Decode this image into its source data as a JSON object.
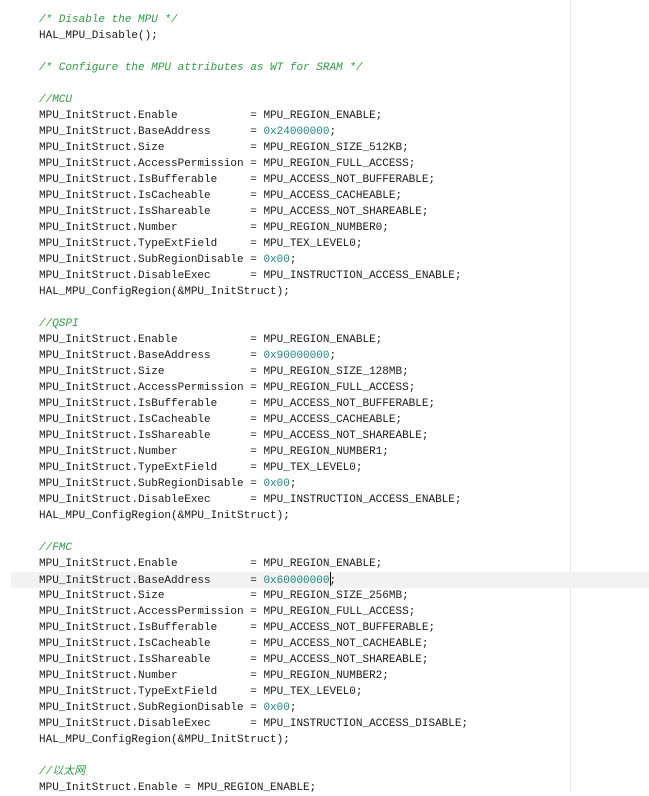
{
  "editor": {
    "active_line": 35,
    "lines": [
      {
        "type": "comment",
        "text": "/* Disable the MPU */"
      },
      {
        "type": "code",
        "text": "HAL_MPU_Disable();"
      },
      {
        "type": "blank",
        "text": ""
      },
      {
        "type": "comment",
        "text": "/* Configure the MPU attributes as WT for SRAM */"
      },
      {
        "type": "blank",
        "text": ""
      },
      {
        "type": "comment",
        "text": "//MCU"
      },
      {
        "type": "assign",
        "lhs": "MPU_InitStruct.Enable",
        "rhs": "MPU_REGION_ENABLE",
        "numeric": false
      },
      {
        "type": "assign",
        "lhs": "MPU_InitStruct.BaseAddress",
        "rhs": "0x24000000",
        "numeric": true
      },
      {
        "type": "assign",
        "lhs": "MPU_InitStruct.Size",
        "rhs": "MPU_REGION_SIZE_512KB",
        "numeric": false
      },
      {
        "type": "assign",
        "lhs": "MPU_InitStruct.AccessPermission",
        "rhs": "MPU_REGION_FULL_ACCESS",
        "numeric": false
      },
      {
        "type": "assign",
        "lhs": "MPU_InitStruct.IsBufferable",
        "rhs": "MPU_ACCESS_NOT_BUFFERABLE",
        "numeric": false
      },
      {
        "type": "assign",
        "lhs": "MPU_InitStruct.IsCacheable",
        "rhs": "MPU_ACCESS_CACHEABLE",
        "numeric": false
      },
      {
        "type": "assign",
        "lhs": "MPU_InitStruct.IsShareable",
        "rhs": "MPU_ACCESS_NOT_SHAREABLE",
        "numeric": false
      },
      {
        "type": "assign",
        "lhs": "MPU_InitStruct.Number",
        "rhs": "MPU_REGION_NUMBER0",
        "numeric": false
      },
      {
        "type": "assign",
        "lhs": "MPU_InitStruct.TypeExtField",
        "rhs": "MPU_TEX_LEVEL0",
        "numeric": false
      },
      {
        "type": "assign",
        "lhs": "MPU_InitStruct.SubRegionDisable",
        "rhs": "0x00",
        "numeric": true
      },
      {
        "type": "assign",
        "lhs": "MPU_InitStruct.DisableExec",
        "rhs": "MPU_INSTRUCTION_ACCESS_ENABLE",
        "numeric": false
      },
      {
        "type": "code",
        "text": "HAL_MPU_ConfigRegion(&MPU_InitStruct);"
      },
      {
        "type": "blank",
        "text": ""
      },
      {
        "type": "comment",
        "text": "//QSPI"
      },
      {
        "type": "assign",
        "lhs": "MPU_InitStruct.Enable",
        "rhs": "MPU_REGION_ENABLE",
        "numeric": false
      },
      {
        "type": "assign",
        "lhs": "MPU_InitStruct.BaseAddress",
        "rhs": "0x90000000",
        "numeric": true
      },
      {
        "type": "assign",
        "lhs": "MPU_InitStruct.Size",
        "rhs": "MPU_REGION_SIZE_128MB",
        "numeric": false
      },
      {
        "type": "assign",
        "lhs": "MPU_InitStruct.AccessPermission",
        "rhs": "MPU_REGION_FULL_ACCESS",
        "numeric": false
      },
      {
        "type": "assign",
        "lhs": "MPU_InitStruct.IsBufferable",
        "rhs": "MPU_ACCESS_NOT_BUFFERABLE",
        "numeric": false
      },
      {
        "type": "assign",
        "lhs": "MPU_InitStruct.IsCacheable",
        "rhs": "MPU_ACCESS_CACHEABLE",
        "numeric": false
      },
      {
        "type": "assign",
        "lhs": "MPU_InitStruct.IsShareable",
        "rhs": "MPU_ACCESS_NOT_SHAREABLE",
        "numeric": false
      },
      {
        "type": "assign",
        "lhs": "MPU_InitStruct.Number",
        "rhs": "MPU_REGION_NUMBER1",
        "numeric": false
      },
      {
        "type": "assign",
        "lhs": "MPU_InitStruct.TypeExtField",
        "rhs": "MPU_TEX_LEVEL0",
        "numeric": false
      },
      {
        "type": "assign",
        "lhs": "MPU_InitStruct.SubRegionDisable",
        "rhs": "0x00",
        "numeric": true
      },
      {
        "type": "assign",
        "lhs": "MPU_InitStruct.DisableExec",
        "rhs": "MPU_INSTRUCTION_ACCESS_ENABLE",
        "numeric": false
      },
      {
        "type": "code",
        "text": "HAL_MPU_ConfigRegion(&MPU_InitStruct);"
      },
      {
        "type": "blank",
        "text": ""
      },
      {
        "type": "comment",
        "text": "//FMC"
      },
      {
        "type": "assign",
        "lhs": "MPU_InitStruct.Enable",
        "rhs": "MPU_REGION_ENABLE",
        "numeric": false
      },
      {
        "type": "assign",
        "lhs": "MPU_InitStruct.BaseAddress",
        "rhs": "0x60000000",
        "numeric": true,
        "caret": true
      },
      {
        "type": "assign",
        "lhs": "MPU_InitStruct.Size",
        "rhs": "MPU_REGION_SIZE_256MB",
        "numeric": false
      },
      {
        "type": "assign",
        "lhs": "MPU_InitStruct.AccessPermission",
        "rhs": "MPU_REGION_FULL_ACCESS",
        "numeric": false
      },
      {
        "type": "assign",
        "lhs": "MPU_InitStruct.IsBufferable",
        "rhs": "MPU_ACCESS_NOT_BUFFERABLE",
        "numeric": false
      },
      {
        "type": "assign",
        "lhs": "MPU_InitStruct.IsCacheable",
        "rhs": "MPU_ACCESS_NOT_CACHEABLE",
        "numeric": false
      },
      {
        "type": "assign",
        "lhs": "MPU_InitStruct.IsShareable",
        "rhs": "MPU_ACCESS_NOT_SHAREABLE",
        "numeric": false
      },
      {
        "type": "assign",
        "lhs": "MPU_InitStruct.Number",
        "rhs": "MPU_REGION_NUMBER2",
        "numeric": false
      },
      {
        "type": "assign",
        "lhs": "MPU_InitStruct.TypeExtField",
        "rhs": "MPU_TEX_LEVEL0",
        "numeric": false
      },
      {
        "type": "assign",
        "lhs": "MPU_InitStruct.SubRegionDisable",
        "rhs": "0x00",
        "numeric": true
      },
      {
        "type": "assign",
        "lhs": "MPU_InitStruct.DisableExec",
        "rhs": "MPU_INSTRUCTION_ACCESS_DISABLE",
        "numeric": false
      },
      {
        "type": "code",
        "text": "HAL_MPU_ConfigRegion(&MPU_InitStruct);"
      },
      {
        "type": "blank",
        "text": ""
      },
      {
        "type": "comment",
        "text": "//以太网"
      },
      {
        "type": "code",
        "text": "MPU_InitStruct.Enable = MPU_REGION_ENABLE;"
      }
    ]
  }
}
